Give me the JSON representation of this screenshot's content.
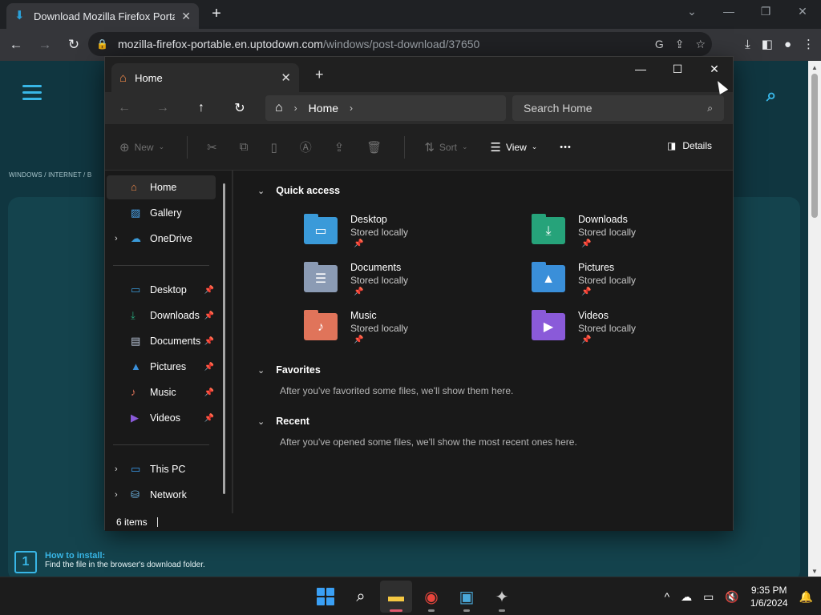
{
  "browser": {
    "tab_title": "Download Mozilla Firefox Portable",
    "tab_close": "✕",
    "new_tab": "+",
    "url_host": "mozilla-firefox-portable.en.uptodown.com",
    "url_path": "/windows/post-download/37650",
    "controls": {
      "minimize": "—",
      "restore": "❐",
      "close": "✕",
      "dropdown": "⌄"
    }
  },
  "webpage": {
    "breadcrumb": "WINDOWS   /   INTERNET   /   B",
    "step_number": "1",
    "step_heading": "How to install:",
    "step_text": "Find the file in the browser's download folder."
  },
  "explorer": {
    "tab_title": "Home",
    "tab_close": "✕",
    "new_tab": "+",
    "window_controls": {
      "minimize": "—",
      "maximize": "☐",
      "close": "✕"
    },
    "breadcrumb": {
      "location": "Home",
      "sep": "›"
    },
    "search_placeholder": "Search Home",
    "commands": {
      "new": "New",
      "sort": "Sort",
      "view": "View",
      "more": "•••",
      "details": "Details"
    },
    "sidebar": {
      "top": [
        {
          "label": "Home",
          "icon": "home-icon"
        },
        {
          "label": "Gallery",
          "icon": "gallery-icon"
        },
        {
          "label": "OneDrive",
          "icon": "cloud-icon"
        }
      ],
      "pinned": [
        {
          "label": "Desktop",
          "icon": "desktop-icon"
        },
        {
          "label": "Downloads",
          "icon": "download-icon"
        },
        {
          "label": "Documents",
          "icon": "document-icon"
        },
        {
          "label": "Pictures",
          "icon": "picture-icon"
        },
        {
          "label": "Music",
          "icon": "music-icon"
        },
        {
          "label": "Videos",
          "icon": "video-icon"
        }
      ],
      "bottom": [
        {
          "label": "This PC",
          "icon": "pc-icon"
        },
        {
          "label": "Network",
          "icon": "network-icon"
        }
      ]
    },
    "quick_access": {
      "title": "Quick access",
      "items": [
        {
          "name": "Desktop",
          "sub": "Stored locally",
          "color": "#3a9ad9"
        },
        {
          "name": "Downloads",
          "sub": "Stored locally",
          "color": "#26a37a"
        },
        {
          "name": "Documents",
          "sub": "Stored locally",
          "color": "#8b9bb4"
        },
        {
          "name": "Pictures",
          "sub": "Stored locally",
          "color": "#3a8fd9"
        },
        {
          "name": "Music",
          "sub": "Stored locally",
          "color": "#e0745a"
        },
        {
          "name": "Videos",
          "sub": "Stored locally",
          "color": "#8a5ad9"
        }
      ]
    },
    "favorites": {
      "title": "Favorites",
      "message": "After you've favorited some files, we'll show them here."
    },
    "recent": {
      "title": "Recent",
      "message": "After you've opened some files, we'll show the most recent ones here."
    },
    "status": "6 items"
  },
  "taskbar": {
    "time": "9:35 PM",
    "date": "1/6/2024"
  }
}
